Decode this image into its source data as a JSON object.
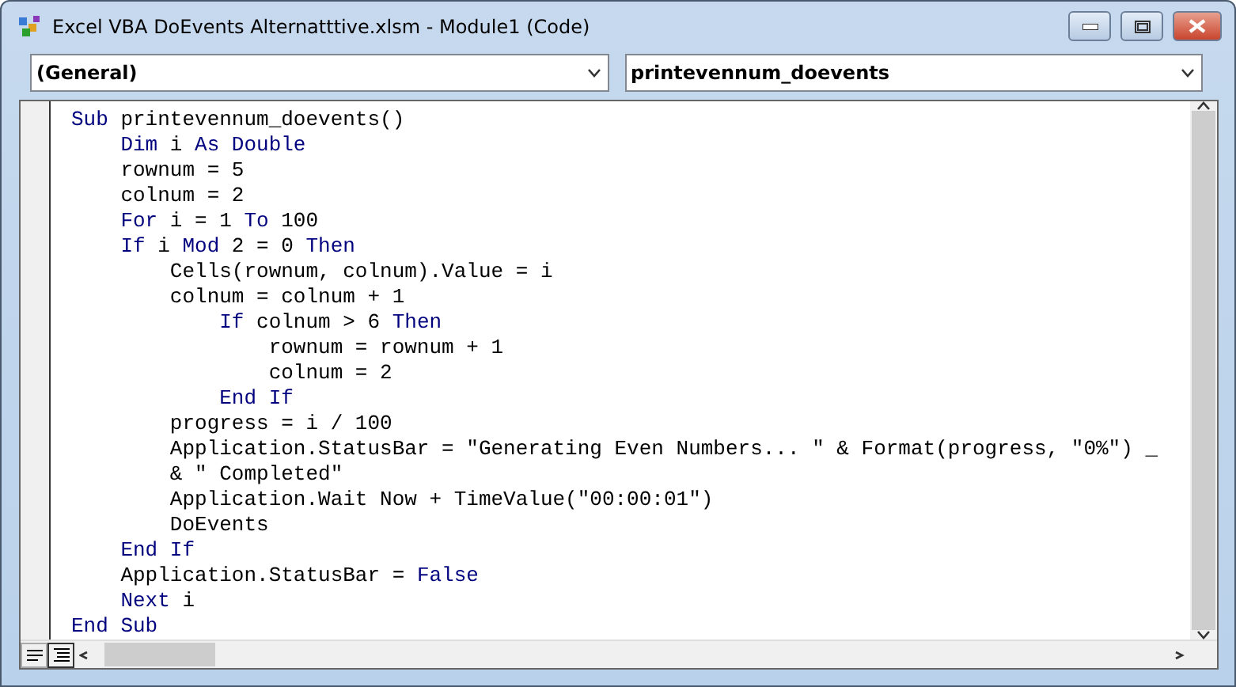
{
  "window": {
    "title": "Excel VBA DoEvents Alternatttive.xlsm - Module1 (Code)"
  },
  "object_dropdown": {
    "value": "(General)"
  },
  "procedure_dropdown": {
    "value": "printevennum_doevents"
  },
  "code_lines": [
    [
      {
        "kind": "keyword",
        "text": "Sub"
      },
      {
        "kind": "plain",
        "text": " printevennum_doevents()"
      }
    ],
    [
      {
        "kind": "keyword",
        "text": "    Dim"
      },
      {
        "kind": "plain",
        "text": " i "
      },
      {
        "kind": "keyword",
        "text": "As Double"
      }
    ],
    [
      {
        "kind": "plain",
        "text": "    rownum = 5"
      }
    ],
    [
      {
        "kind": "plain",
        "text": "    colnum = 2"
      }
    ],
    [
      {
        "kind": "keyword",
        "text": "    For"
      },
      {
        "kind": "plain",
        "text": " i = 1 "
      },
      {
        "kind": "keyword",
        "text": "To"
      },
      {
        "kind": "plain",
        "text": " 100"
      }
    ],
    [
      {
        "kind": "keyword",
        "text": "    If"
      },
      {
        "kind": "plain",
        "text": " i "
      },
      {
        "kind": "keyword",
        "text": "Mod"
      },
      {
        "kind": "plain",
        "text": " 2 = 0 "
      },
      {
        "kind": "keyword",
        "text": "Then"
      }
    ],
    [
      {
        "kind": "plain",
        "text": "        Cells(rownum, colnum).Value = i"
      }
    ],
    [
      {
        "kind": "plain",
        "text": "        colnum = colnum + 1"
      }
    ],
    [
      {
        "kind": "keyword",
        "text": "            If"
      },
      {
        "kind": "plain",
        "text": " colnum > 6 "
      },
      {
        "kind": "keyword",
        "text": "Then"
      }
    ],
    [
      {
        "kind": "plain",
        "text": "                rownum = rownum + 1"
      }
    ],
    [
      {
        "kind": "plain",
        "text": "                colnum = 2"
      }
    ],
    [
      {
        "kind": "keyword",
        "text": "            End If"
      }
    ],
    [
      {
        "kind": "plain",
        "text": "        progress = i / 100"
      }
    ],
    [
      {
        "kind": "plain",
        "text": "        Application.StatusBar = \"Generating Even Numbers... \" & Format(progress, \"0%\") _"
      }
    ],
    [
      {
        "kind": "plain",
        "text": "        & \" Completed\""
      }
    ],
    [
      {
        "kind": "plain",
        "text": "        Application.Wait Now + TimeValue(\"00:00:01\")"
      }
    ],
    [
      {
        "kind": "plain",
        "text": "        DoEvents"
      }
    ],
    [
      {
        "kind": "keyword",
        "text": "    End If"
      }
    ],
    [
      {
        "kind": "plain",
        "text": "    Application.StatusBar = "
      },
      {
        "kind": "keyword",
        "text": "False"
      }
    ],
    [
      {
        "kind": "keyword",
        "text": "    Next"
      },
      {
        "kind": "plain",
        "text": " i"
      }
    ],
    [
      {
        "kind": "keyword",
        "text": "End Sub"
      }
    ]
  ]
}
